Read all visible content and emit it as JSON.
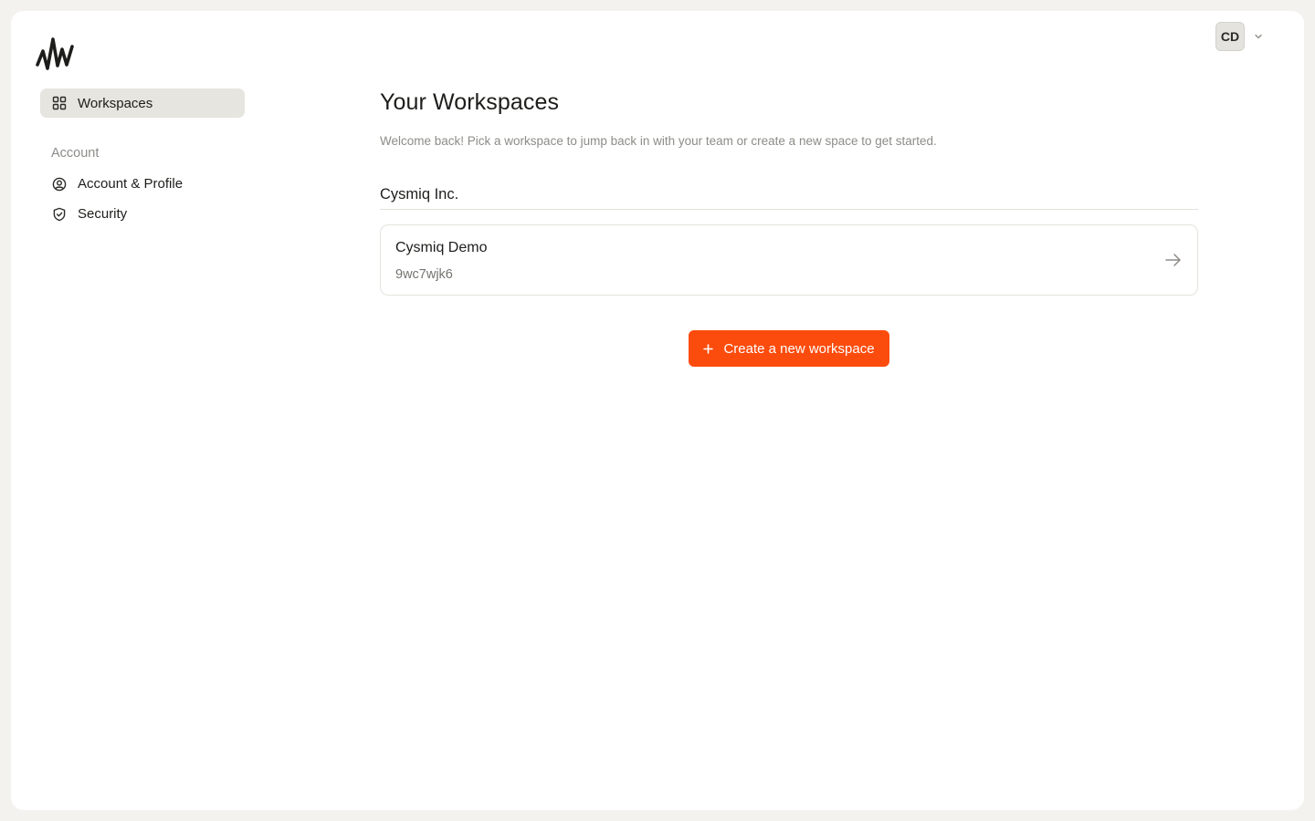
{
  "brand": {
    "logo_icon": "waveform-logo-icon"
  },
  "user_menu": {
    "initials": "CD",
    "chevron_icon": "chevron-down-icon"
  },
  "sidebar": {
    "items": [
      {
        "label": "Workspaces",
        "icon": "grid-icon",
        "active": true
      }
    ],
    "section_label": "Account",
    "account_items": [
      {
        "label": "Account & Profile",
        "icon": "user-circle-icon"
      },
      {
        "label": "Security",
        "icon": "shield-check-icon"
      }
    ]
  },
  "main": {
    "title": "Your Workspaces",
    "subtitle": "Welcome back! Pick a workspace to jump back in with your team or create a new space to get started.",
    "organizations": [
      {
        "name": "Cysmiq Inc.",
        "workspaces": [
          {
            "name": "Cysmiq Demo",
            "id": "9wc7wjk6",
            "icon": "arrow-right-icon"
          }
        ]
      }
    ],
    "create_button_label": "Create a new workspace",
    "create_button_icon": "plus-icon"
  },
  "colors": {
    "accent": "#fc4c0d",
    "background": "#f3f2ee",
    "surface": "#ffffff",
    "active_nav": "#e6e5df"
  }
}
